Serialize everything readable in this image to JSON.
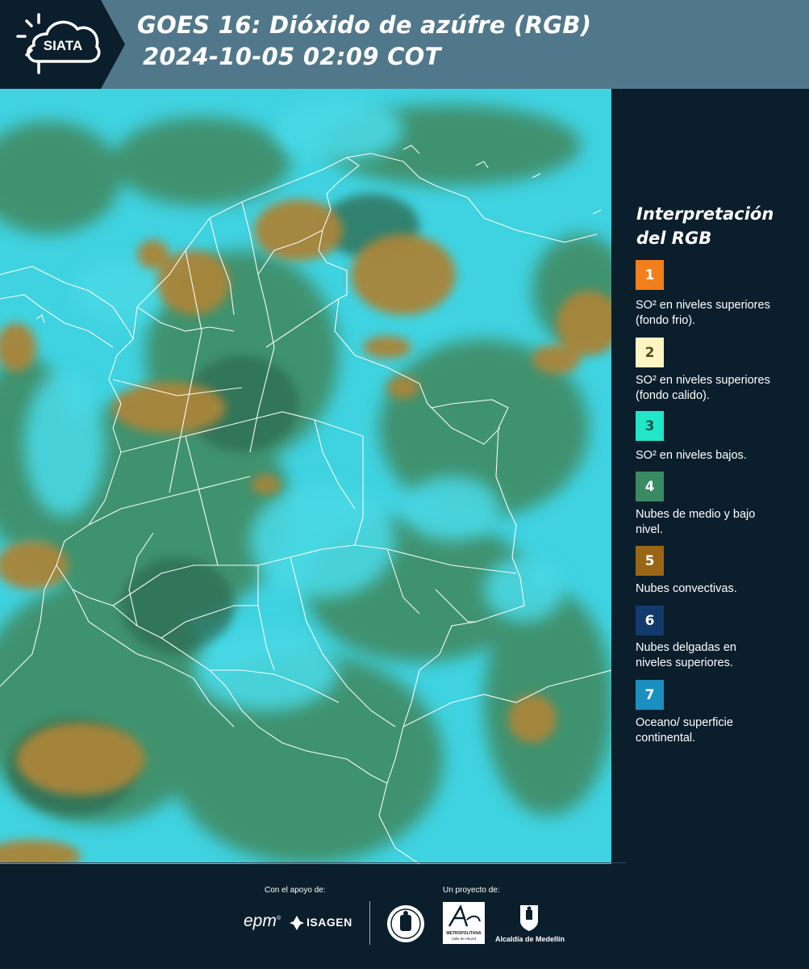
{
  "header": {
    "logo_text": "SIATA",
    "title_line1": "GOES 16: Dióxido de azúfre (RGB)",
    "title_line2": "2024-10-05 02:09 COT"
  },
  "legend": {
    "title": "Interpretación del RGB",
    "items": [
      {
        "number": "1",
        "color": "#f27f1b",
        "text_color": "#ffffff",
        "label": "SO² en niveles superiores (fondo frio)."
      },
      {
        "number": "2",
        "color": "#fff5c2",
        "text_color": "#5a4c1a",
        "label": "SO² en niveles superiores (fondo calido)."
      },
      {
        "number": "3",
        "color": "#22e6c8",
        "text_color": "#145a4c",
        "label": "SO² en niveles bajos."
      },
      {
        "number": "4",
        "color": "#3a8a64",
        "text_color": "#ffffff",
        "label": "Nubes de medio y bajo nivel."
      },
      {
        "number": "5",
        "color": "#9a6514",
        "text_color": "#ffffff",
        "label": "Nubes convectivas."
      },
      {
        "number": "6",
        "color": "#123a6c",
        "text_color": "#ffffff",
        "label": "Nubes delgadas en niveles superiores."
      },
      {
        "number": "7",
        "color": "#1a8fc0",
        "text_color": "#ffffff",
        "label": "Oceano/ superficie continental."
      }
    ]
  },
  "footer": {
    "support_label": "Con el apoyo de:",
    "project_label": "Un proyecto de:",
    "epm": "epm",
    "isagen": "ISAGEN",
    "metropolitana": "METROPOLITANA",
    "metropolitana_sub": "Valle de Aburrá",
    "alcaldia": "Alcaldía de Medellín"
  },
  "map_colors": {
    "cyan": "#3fd2e0",
    "green": "#3f8f6a",
    "dark_green": "#2f6e55",
    "brown": "#a8853a",
    "border": "#ffffff"
  }
}
